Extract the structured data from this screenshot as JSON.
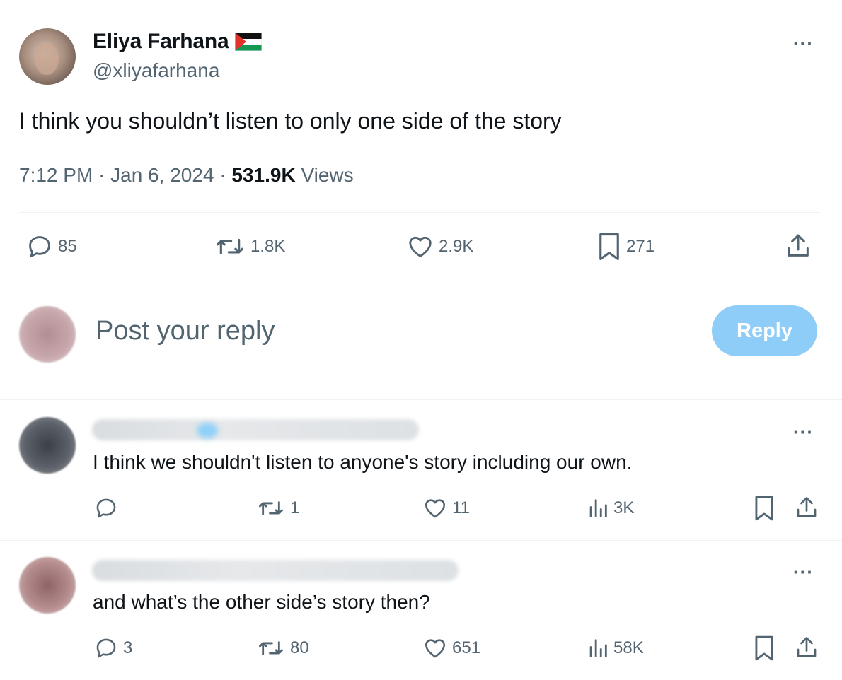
{
  "tweet": {
    "author_name": "Eliya Farhana",
    "author_handle": "@xliyafarhana",
    "more_label": "···",
    "text": "I think you shouldn’t listen to only one side of the story",
    "time": "7:12 PM · Jan 6, 2024 · ",
    "views_count": "531.9K",
    "views_label": "Views",
    "stats": {
      "replies": "85",
      "reposts": "1.8K",
      "likes": "2.9K",
      "bookmarks": "271"
    }
  },
  "composer": {
    "placeholder": "Post your reply",
    "reply_button": "Reply"
  },
  "replies": [
    {
      "text": "I think we shouldn't listen to anyone's story including our own.",
      "more_label": "···",
      "stats": {
        "replies": "",
        "reposts": "1",
        "likes": "11",
        "views": "3K"
      }
    },
    {
      "text": "and what’s the other side’s story then?",
      "more_label": "···",
      "stats": {
        "replies": "3",
        "reposts": "80",
        "likes": "651",
        "views": "58K"
      }
    }
  ],
  "colors": {
    "accent": "#1d9bf0",
    "reply_button_bg": "#8ecdf8",
    "muted": "#536471"
  }
}
